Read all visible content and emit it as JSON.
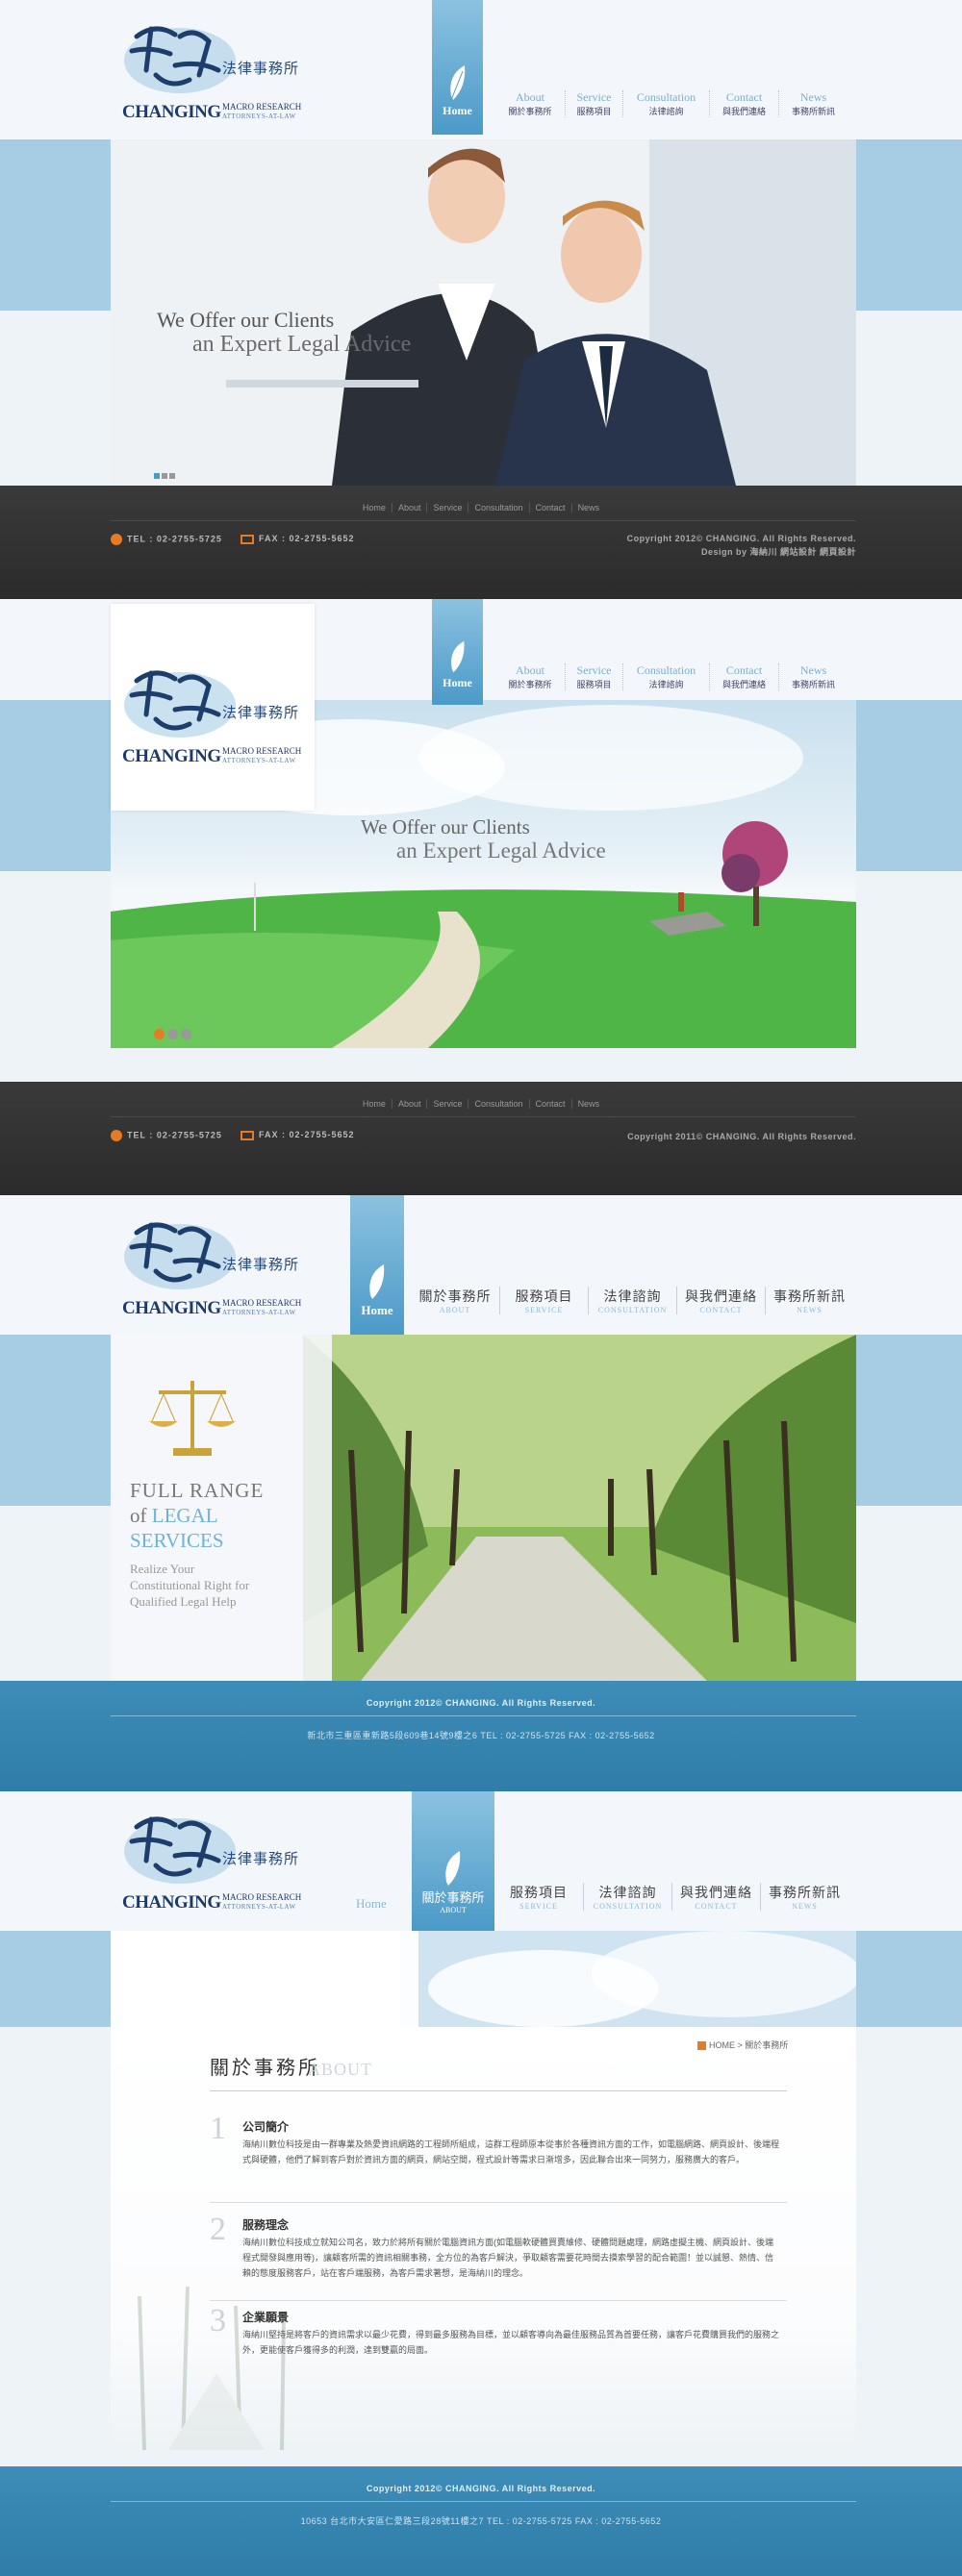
{
  "brand": {
    "sub_cn": "法律事務所",
    "name_en": "CHANGING",
    "sub_en1": "MACRO RESEARCH",
    "sub_en2": "ATTORNEYS-AT-LAW"
  },
  "nav_v1": {
    "home": "Home",
    "items": [
      {
        "en": "About",
        "zh": "關於事務所"
      },
      {
        "en": "Service",
        "zh": "服務項目"
      },
      {
        "en": "Consultation",
        "zh": "法律諮詢"
      },
      {
        "en": "Contact",
        "zh": "與我們連絡"
      },
      {
        "en": "News",
        "zh": "事務所新訊"
      }
    ]
  },
  "nav_v2": {
    "home": "Home",
    "items": [
      {
        "zh": "關於事務所",
        "en": "ABOUT"
      },
      {
        "zh": "服務項目",
        "en": "SERVICE"
      },
      {
        "zh": "法律諮詢",
        "en": "CONSULTATION"
      },
      {
        "zh": "與我們連絡",
        "en": "CONTACT"
      },
      {
        "zh": "事務所新訊",
        "en": "NEWS"
      }
    ]
  },
  "hero": {
    "line1": "We Offer our Clients",
    "line2": "an Expert Legal Advice"
  },
  "hero3": {
    "l1": "FULL RANGE",
    "l2_of": "of",
    "l2_legal": "LEGAL",
    "l3": "SERVICES",
    "t1": "Realize Your",
    "t2": "Constitutional Right for",
    "t3": "Qualified Legal Help"
  },
  "footer_nav": [
    "Home",
    "About",
    "Service",
    "Consultation",
    "Contact",
    "News"
  ],
  "contact": {
    "tel": "TEL : 02-2755-5725",
    "fax": "FAX : 02-2755-5652"
  },
  "footer1": {
    "copy": "Copyright 2012© CHANGING. All Rights Reserved.",
    "design": "Design by 海納川 網站設計 網頁設計"
  },
  "footer2": {
    "copy": "Copyright 2011© CHANGING. All Rights Reserved."
  },
  "footer3": {
    "copy": "Copyright 2012© CHANGING. All Rights Reserved.",
    "addr": "新北市三重區重新路5段609巷14號9樓之6   TEL : 02-2755-5725   FAX : 02-2755-5652"
  },
  "footer4": {
    "copy": "Copyright 2012© CHANGING. All Rights Reserved.",
    "addr": "10653 台北市大安區仁愛路三段28號11樓之7   TEL : 02-2755-5725   FAX : 02-2755-5652"
  },
  "about": {
    "title": "關於事務所",
    "title_en": "ABOUT",
    "crumb_home": "HOME",
    "crumb_cur": "關於事務所",
    "sections": [
      {
        "num": "1",
        "h": "公司簡介",
        "p": "海納川數位科技是由一群專業及熱愛資訊網路的工程師所組成，這群工程師原本從事於各種資訊方面的工作，如電腦網路、網頁設計、後端程式與硬體，他們了解到客戶對於資訊方面的網頁，網站空間，程式設計等需求日漸增多，因此聯合出來一同努力，服務廣大的客戶。"
      },
      {
        "num": "2",
        "h": "服務理念",
        "p": "海納川數位科技成立就知公司名，致力於將所有關於電腦資訊方面(如電腦軟硬體買賣維修、硬體問題處理，網路虛擬主機、網頁設計、後端程式開發與應用等)，讓顧客所需的資訊相關事務，全方位的為客戶解決，爭取顧客需要花時間去摸索學習的配合範圍！並以誠懇、熱情、信賴的態度服務客戶，站在客戶端服務，為客戶需求著想，是海納川的理念。"
      },
      {
        "num": "3",
        "h": "企業願景",
        "p": "海納川堅持是將客戶的資訊需求以最少花費，得到最多服務為目標，並以顧客導向為最佳服務品質為首要任務，讓客戶花費購買我們的服務之外，更能使客戶獲得多的利潤，達到雙贏的局面。"
      }
    ]
  }
}
